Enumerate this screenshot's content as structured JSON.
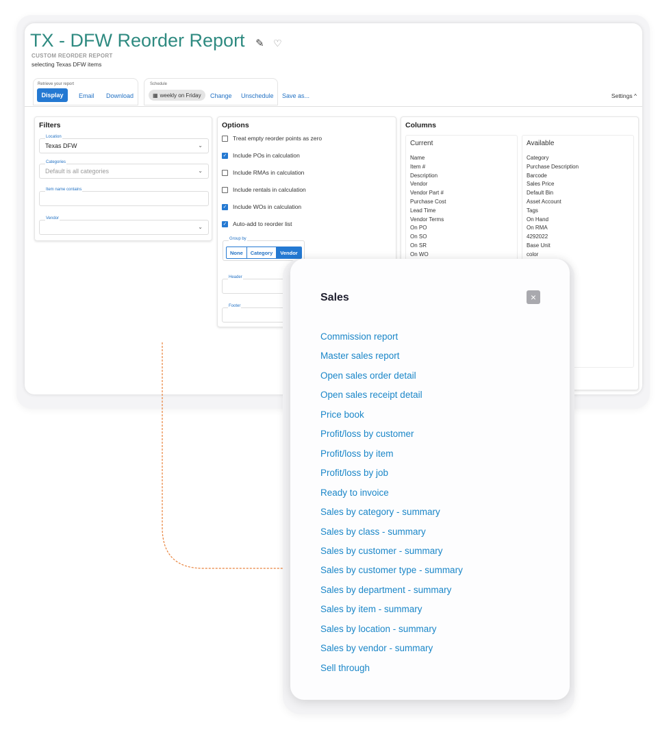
{
  "report": {
    "title": "TX - DFW Reorder Report",
    "subtitle": "CUSTOM REORDER REPORT",
    "description": "selecting Texas DFW items",
    "edit_icon": "pencil-icon",
    "favorite_icon": "heart-icon"
  },
  "toolbar": {
    "retrieve_label": "Retrieve your report",
    "display": "Display",
    "email": "Email",
    "download": "Download",
    "schedule_label": "Schedule",
    "schedule_value": "weekly on Friday",
    "change": "Change",
    "unschedule": "Unschedule",
    "save_as": "Save as...",
    "settings": "Settings ^"
  },
  "filters": {
    "title": "Filters",
    "location_label": "Location",
    "location_value": "Texas DFW",
    "categories_label": "Categories",
    "categories_placeholder": "Default is all categories",
    "item_name_label": "Item name contains",
    "vendor_label": "Vendor"
  },
  "options": {
    "title": "Options",
    "items": [
      {
        "label": "Treat empty reorder points as zero",
        "checked": false
      },
      {
        "label": "Include POs in calculation",
        "checked": true
      },
      {
        "label": "Include RMAs in calculation",
        "checked": false
      },
      {
        "label": "Include rentals in calculation",
        "checked": false
      },
      {
        "label": "Include WOs in calculation",
        "checked": true
      },
      {
        "label": "Auto-add to reorder list",
        "checked": true
      }
    ],
    "group_by_label": "Group by",
    "group_by": [
      "None",
      "Category",
      "Vendor"
    ],
    "group_by_selected": "Vendor",
    "header_label": "Header",
    "footer_label": "Footer"
  },
  "columns": {
    "title": "Columns",
    "current_title": "Current",
    "current": [
      "Name",
      "Item #",
      "Description",
      "Vendor",
      "Vendor Part #",
      "Purchase Cost",
      "Lead Time",
      "Vendor Terms",
      "On PO",
      "On SO",
      "On SR",
      "On WO"
    ],
    "available_title": "Available",
    "available": [
      "Category",
      "Purchase Description",
      "Barcode",
      "Sales Price",
      "Default Bin",
      "Asset Account",
      "Tags",
      "On Hand",
      "On RMA",
      "4292022",
      "Base Unit",
      "color"
    ]
  },
  "sales": {
    "title": "Sales",
    "close_icon": "close-icon",
    "links": [
      "Commission report",
      "Master sales report",
      "Open sales order detail",
      "Open sales receipt detail",
      "Price book",
      "Profit/loss by customer",
      "Profit/loss by item",
      "Profit/loss by job",
      "Ready to invoice",
      "Sales by category - summary",
      "Sales by class - summary",
      "Sales by customer - summary",
      "Sales by customer type - summary",
      "Sales by department - summary",
      "Sales by item - summary",
      "Sales by location - summary",
      "Sales by vendor - summary",
      "Sell through"
    ]
  },
  "colors": {
    "title_teal": "#2e8a80",
    "primary_blue": "#2479d2",
    "link_blue": "#1a86c8",
    "connector_orange": "#e8813a"
  }
}
